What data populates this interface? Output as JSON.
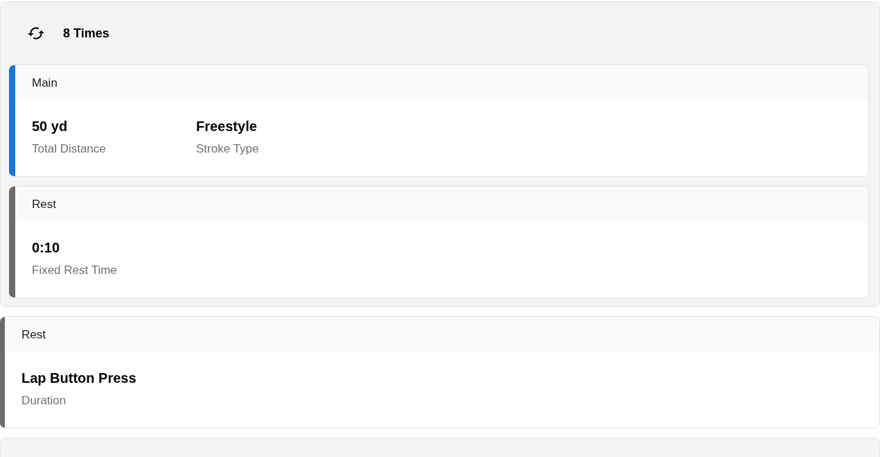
{
  "blocks": [
    {
      "kind": "repeat",
      "label": "8 Times",
      "steps": [
        {
          "title": "Main",
          "color": "#1976d2",
          "stats": [
            {
              "value": "50 yd",
              "label": "Total Distance"
            },
            {
              "value": "Freestyle",
              "label": "Stroke Type"
            }
          ]
        },
        {
          "title": "Rest",
          "color": "#6b6b6b",
          "stats": [
            {
              "value": "0:10",
              "label": "Fixed Rest Time"
            }
          ]
        }
      ]
    },
    {
      "kind": "step",
      "title": "Rest",
      "color": "#6b6b6b",
      "stats": [
        {
          "value": "Lap Button Press",
          "label": "Duration"
        }
      ]
    },
    {
      "kind": "panel"
    }
  ]
}
